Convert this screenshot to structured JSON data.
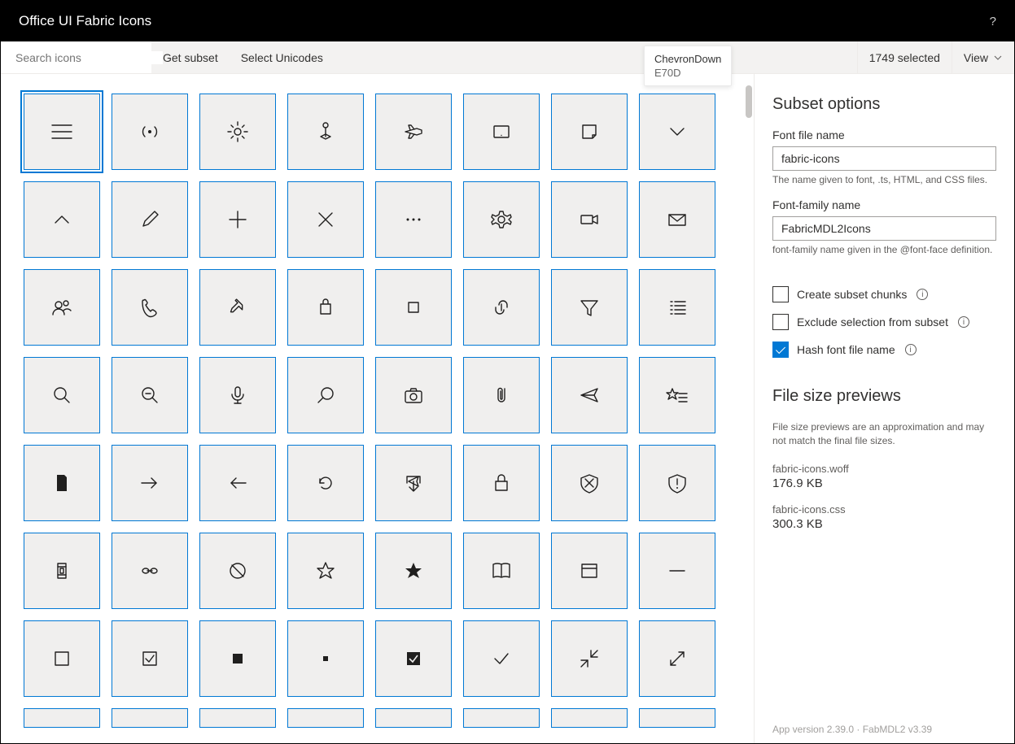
{
  "header": {
    "title": "Office UI Fabric Icons",
    "help": "?"
  },
  "toolbar": {
    "search_placeholder": "Search icons",
    "get_subset": "Get subset",
    "select_unicodes": "Select Unicodes",
    "selected_status": "1749 selected",
    "view": "View"
  },
  "tooltip": {
    "name": "ChevronDown",
    "code": "E70D"
  },
  "icons": [
    "GlobalNavButton",
    "InternetSharing",
    "Brightness",
    "MapPin",
    "Airplane",
    "Tablet",
    "QuickNote",
    "ChevronDown",
    "ChevronUp",
    "Edit",
    "Add",
    "Cancel",
    "More",
    "Settings",
    "Video",
    "Mail",
    "People",
    "Phone",
    "Pin",
    "Shop",
    "Stop",
    "Link",
    "Filter",
    "AllApps",
    "Zoom",
    "ZoomOut",
    "Microphone",
    "Search",
    "Camera",
    "Attach",
    "Send",
    "FavoriteList",
    "PageFill",
    "Forward",
    "Back",
    "Refresh",
    "Share",
    "Lock",
    "BlockedSite",
    "ReportHacked",
    "EMI",
    "MiniLink",
    "Blocked",
    "FavoriteStar",
    "FavoriteStarFill",
    "ReadingMode",
    "Favicon",
    "Remove",
    "Checkbox",
    "CheckboxComposite",
    "CheckboxFill",
    "CheckboxIndeterminate",
    "CheckboxCompositeReversed",
    "CheckMark",
    "BackToWindow",
    "FullScreen"
  ],
  "side": {
    "heading": "Subset options",
    "font_file_label": "Font file name",
    "font_file_value": "fabric-icons",
    "font_file_hint": "The name given to font, .ts, HTML, and CSS files.",
    "font_family_label": "Font-family name",
    "font_family_value": "FabricMDL2Icons",
    "font_family_hint": "font-family name given in the @font-face definition.",
    "cb_chunks": "Create subset chunks",
    "cb_exclude": "Exclude selection from subset",
    "cb_hash": "Hash font file name",
    "preview_heading": "File size previews",
    "preview_note": "File size previews are an approximation and may not match the final file sizes.",
    "files": [
      {
        "name": "fabric-icons.woff",
        "size": "176.9 KB"
      },
      {
        "name": "fabric-icons.css",
        "size": "300.3 KB"
      }
    ]
  },
  "footer": "App version 2.39.0  ·  FabMDL2 v3.39"
}
